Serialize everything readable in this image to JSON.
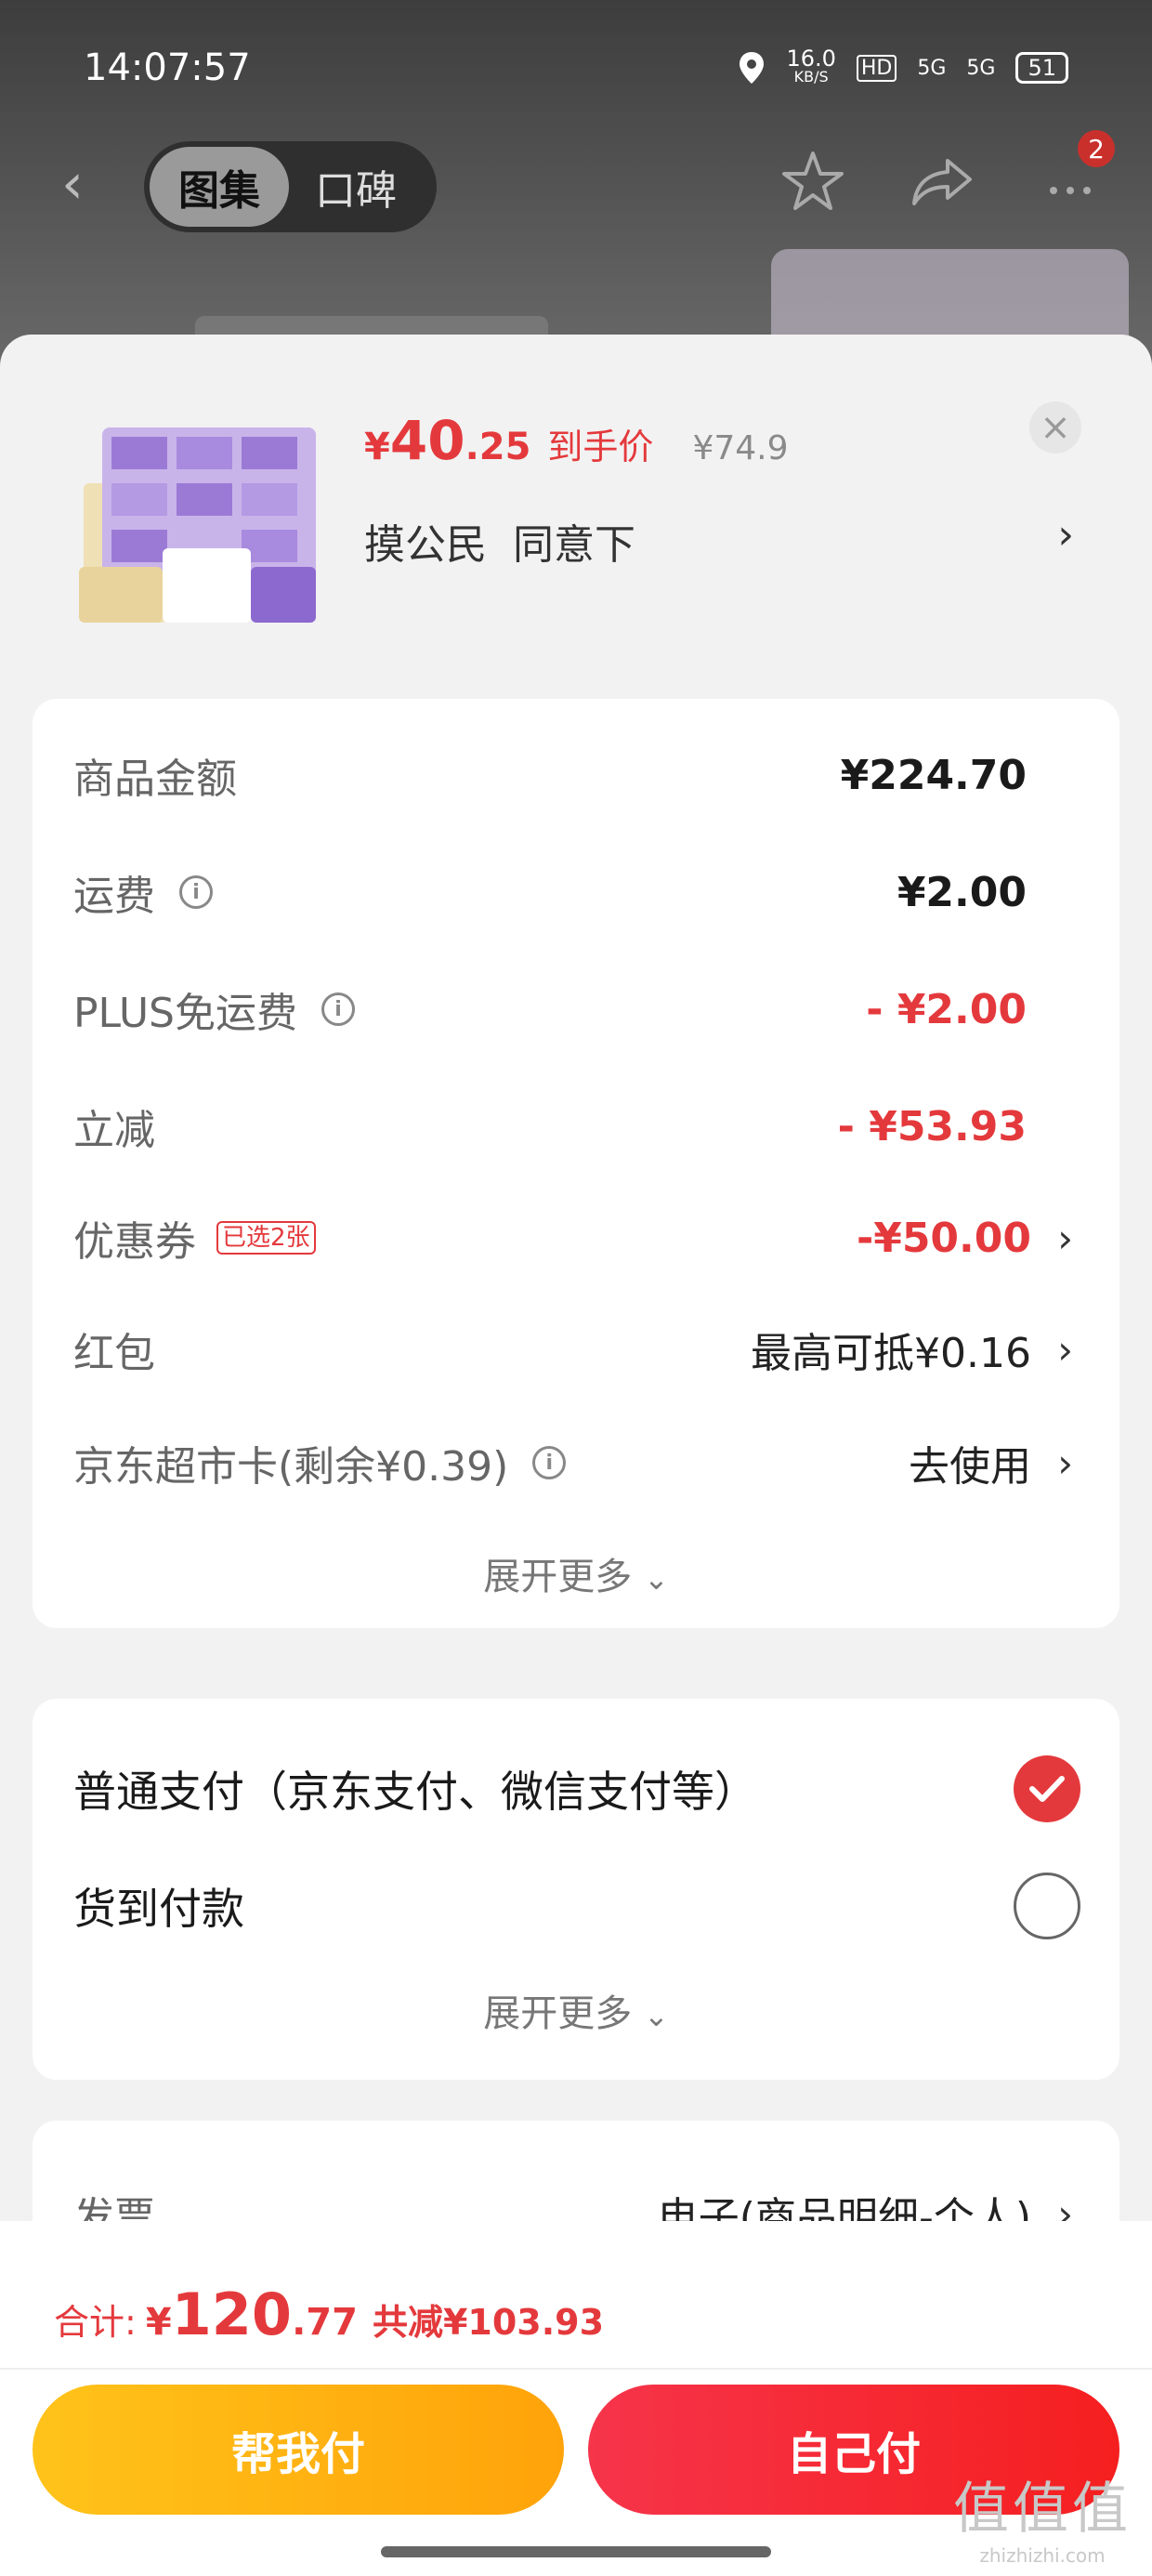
{
  "status_bar": {
    "time": "14:07:57",
    "net_speed": "16.0",
    "net_unit": "KB/S",
    "hd": "HD",
    "signal1": "5G",
    "signal2": "5G",
    "battery": "51"
  },
  "nav": {
    "tab_gallery": "图集",
    "tab_reviews": "口碑",
    "more_badge": "2"
  },
  "product": {
    "price_symbol": "¥",
    "price_int": "40",
    "price_dec": ".25",
    "price_tag": "到手价",
    "original_price": "¥74.9",
    "spec": "摸公民  同意下",
    "close": "×"
  },
  "fees": {
    "goods_label": "商品金额",
    "goods_value": "¥224.70",
    "shipping_label": "运费",
    "shipping_value": "¥2.00",
    "plus_label": "PLUS免运费",
    "plus_value": "- ¥2.00",
    "discount_label": "立减",
    "discount_value": "- ¥53.93",
    "coupon_label": "优惠券",
    "coupon_chip": "已选2张",
    "coupon_value": "-¥50.00",
    "redpacket_label": "红包",
    "redpacket_value": "最高可抵¥0.16",
    "card_label": "京东超市卡(剩余¥0.39)",
    "card_value": "去使用",
    "expand": "展开更多"
  },
  "payment": {
    "normal": "普通支付（京东支付、微信支付等）",
    "cod": "货到付款",
    "expand": "展开更多"
  },
  "invoice": {
    "label": "发票",
    "value": "电子(商品明细-个人)"
  },
  "summary": {
    "total_label": "合计:",
    "total_symbol": "¥",
    "total_int": "120",
    "total_dec": ".77",
    "saved": "共减¥103.93"
  },
  "buttons": {
    "help_pay": "帮我付",
    "self_pay": "自己付"
  },
  "watermark": {
    "big": "值值值",
    "small": "zhizhizhi.com"
  },
  "colors": {
    "accent_red": "#e4393c",
    "help_button": "#ffb212",
    "self_button": "#f52a35"
  }
}
